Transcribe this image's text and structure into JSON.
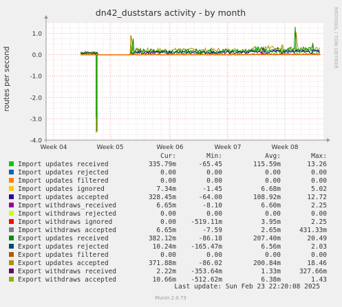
{
  "chart_data": {
    "type": "line",
    "title": "dn42_duststars activity - by month",
    "ylabel": "routes per second",
    "ylim": [
      -4.0,
      1.5
    ],
    "y_ticks": [
      1.0,
      0.0,
      -1.0,
      -2.0,
      -3.0,
      -4.0
    ],
    "y_tick_labels": [
      "1.0",
      "0.0",
      "-1.0",
      "-2.0",
      "-3.0",
      "-4.0"
    ],
    "x_ticks": [
      "Week 04",
      "Week 05",
      "Week 06",
      "Week 07",
      "Week 08"
    ],
    "grid": true,
    "side_text": "RRDTOOL / TOBI OETIKER",
    "column_headers": [
      "Cur:",
      "Min:",
      "Avg:",
      "Max:"
    ],
    "series": [
      {
        "name": "Import updates received",
        "color": "#00cc00",
        "cur": "335.79m",
        "min": "-65.45",
        "avg": "115.59m",
        "max": "13.26"
      },
      {
        "name": "Import updates rejected",
        "color": "#0066b3",
        "cur": "0.00",
        "min": "0.00",
        "avg": "0.00",
        "max": "0.00"
      },
      {
        "name": "Import updates filtered",
        "color": "#ff8000",
        "cur": "0.00",
        "min": "0.00",
        "avg": "0.00",
        "max": "0.00"
      },
      {
        "name": "Import updates ignored",
        "color": "#ffcc00",
        "cur": "7.34m",
        "min": "-1.45",
        "avg": "6.68m",
        "max": "5.02"
      },
      {
        "name": "Import updates accepted",
        "color": "#330099",
        "cur": "328.45m",
        "min": "-64.00",
        "avg": "108.92m",
        "max": "12.72"
      },
      {
        "name": "Import withdraws_received",
        "color": "#990099",
        "cur": "6.65m",
        "min": "-8.10",
        "avg": "6.60m",
        "max": "2.25"
      },
      {
        "name": "Import withdraws rejected",
        "color": "#ccff00",
        "cur": "0.00",
        "min": "0.00",
        "avg": "0.00",
        "max": "0.00"
      },
      {
        "name": "Import withdraws ignored",
        "color": "#ff0000",
        "cur": "0.00",
        "min": "-519.11m",
        "avg": "3.95m",
        "max": "2.25"
      },
      {
        "name": "Import withdraws accepted",
        "color": "#808080",
        "cur": "6.65m",
        "min": "-7.59",
        "avg": "2.65m",
        "max": "431.33m"
      },
      {
        "name": "Export updates received",
        "color": "#008f00",
        "cur": "382.12m",
        "min": "-86.18",
        "avg": "207.40m",
        "max": "20.49"
      },
      {
        "name": "Export updates rejected",
        "color": "#00487d",
        "cur": "10.24m",
        "min": "-165.47m",
        "avg": "6.56m",
        "max": "2.03"
      },
      {
        "name": "Export updates filtered",
        "color": "#b35a00",
        "cur": "0.00",
        "min": "0.00",
        "avg": "0.00",
        "max": "0.00"
      },
      {
        "name": "Export updates accepted",
        "color": "#b38f00",
        "cur": "371.88m",
        "min": "-86.02",
        "avg": "200.84m",
        "max": "18.46"
      },
      {
        "name": "Export withdraws received",
        "color": "#6b006b",
        "cur": "2.22m",
        "min": "-353.64m",
        "avg": "1.33m",
        "max": "327.66m"
      },
      {
        "name": "Export withdraws accepted",
        "color": "#8fb300",
        "cur": "10.66m",
        "min": "-512.62m",
        "avg": "6.38m",
        "max": "1.43"
      }
    ]
  },
  "last_update": "Last update: Sun Feb 23 22:20:08 2025",
  "footer": "Munin 2.0.73"
}
